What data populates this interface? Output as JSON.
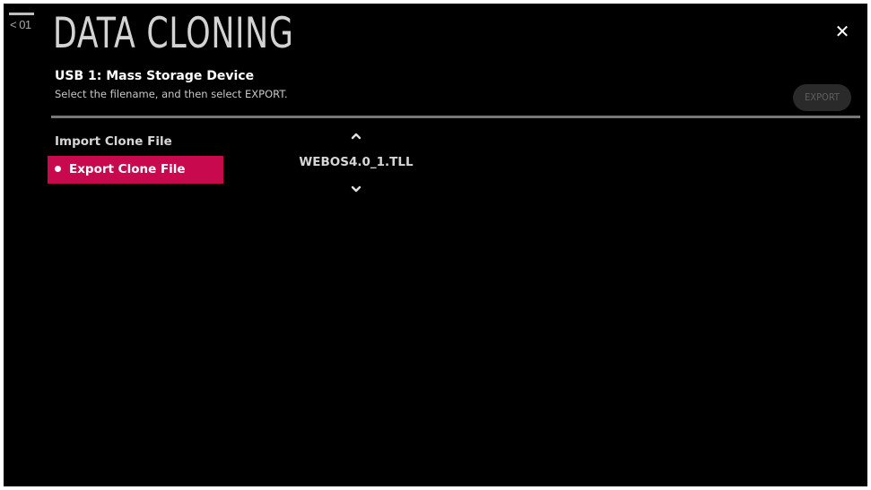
{
  "nav": {
    "back_label": "< 01"
  },
  "header": {
    "title": "DATA CLONING",
    "device": "USB 1: Mass Storage Device",
    "instruction": "Select the filename, and then select EXPORT.",
    "close_icon": "close-icon",
    "close_glyph": "✕"
  },
  "actions": {
    "export_label": "EXPORT",
    "export_enabled": false
  },
  "menu": {
    "items": [
      {
        "label": "Import Clone File",
        "selected": false
      },
      {
        "label": "Export Clone File",
        "selected": true
      }
    ]
  },
  "file_list": {
    "selected_file": "WEBOS4.0_1.TLL",
    "up_icon": "chevron-up-icon",
    "down_icon": "chevron-down-icon"
  },
  "colors": {
    "background": "#000000",
    "accent": "#c8094d",
    "text": "#d6d6d6",
    "disabled": "#5e5e5e"
  }
}
